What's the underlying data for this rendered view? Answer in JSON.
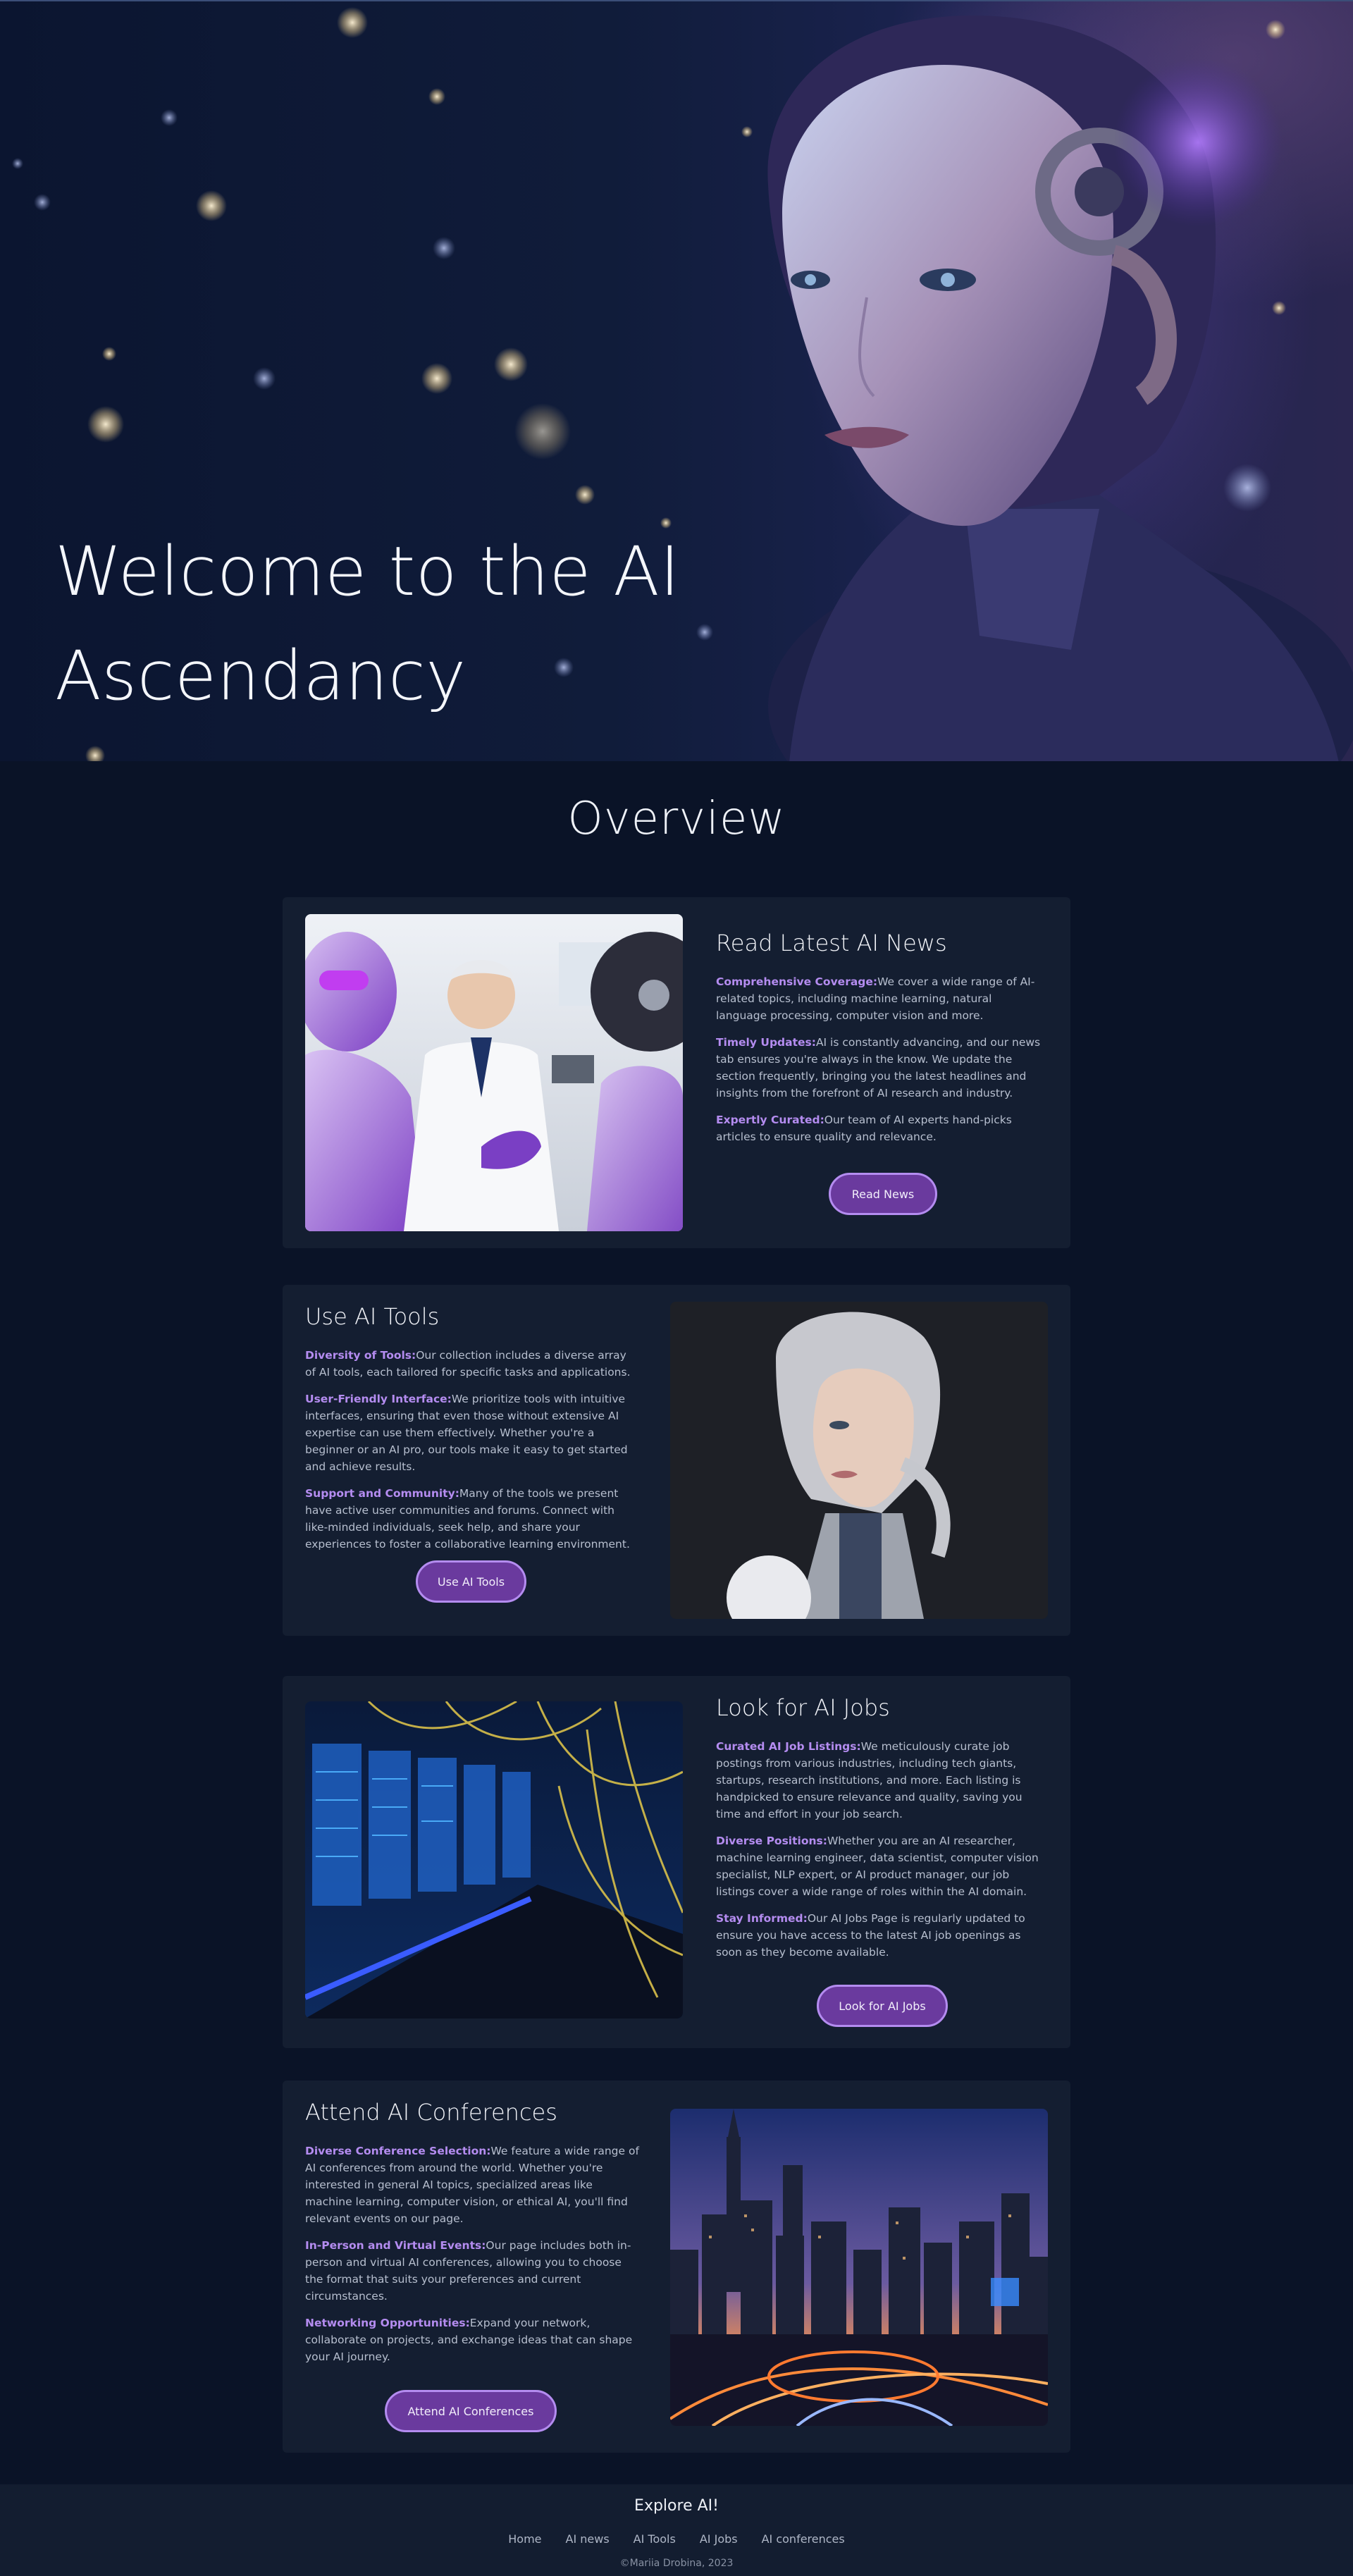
{
  "hero": {
    "title_line1": "Welcome to the AI",
    "title_line2": "Ascendancy"
  },
  "overview": {
    "title": "Overview"
  },
  "sections": [
    {
      "title": "Read Latest AI News",
      "points": [
        {
          "label": "Comprehensive Coverage:",
          "text": "We cover a wide range of AI-related topics, including machine learning, natural language processing, computer vision and more."
        },
        {
          "label": "Timely Updates:",
          "text": "AI is constantly advancing, and our news tab ensures you're always in the know. We update the section frequently, bringing you the latest headlines and insights from the forefront of AI research and industry."
        },
        {
          "label": "Expertly Curated:",
          "text": "Our team of AI experts hand-picks articles to ensure quality and relevance."
        }
      ],
      "button": "Read News"
    },
    {
      "title": "Use AI Tools",
      "points": [
        {
          "label": "Diversity of Tools:",
          "text": "Our collection includes a diverse array of AI tools, each tailored for specific tasks and applications."
        },
        {
          "label": "User-Friendly Interface:",
          "text": "We prioritize tools with intuitive interfaces, ensuring that even those without extensive AI expertise can use them effectively. Whether you're a beginner or an AI pro, our tools make it easy to get started and achieve results."
        },
        {
          "label": "Support and Community:",
          "text": "Many of the tools we present have active user communities and forums. Connect with like-minded individuals, seek help, and share your experiences to foster a collaborative learning environment."
        }
      ],
      "button": "Use AI Tools"
    },
    {
      "title": "Look for AI Jobs",
      "points": [
        {
          "label": "Curated AI Job Listings:",
          "text": "We meticulously curate job postings from various industries, including tech giants, startups, research institutions, and more. Each listing is handpicked to ensure relevance and quality, saving you time and effort in your job search."
        },
        {
          "label": "Diverse Positions:",
          "text": "Whether you are an AI researcher, machine learning engineer, data scientist, computer vision specialist, NLP expert, or AI product manager, our job listings cover a wide range of roles within the AI domain."
        },
        {
          "label": "Stay Informed:",
          "text": "Our AI Jobs Page is regularly updated to ensure you have access to the latest AI job openings as soon as they become available."
        }
      ],
      "button": "Look for AI Jobs"
    },
    {
      "title": "Attend AI Conferences",
      "points": [
        {
          "label": "Diverse Conference Selection:",
          "text": "We feature a wide range of AI conferences from around the world. Whether you're interested in general AI topics, specialized areas like machine learning, computer vision, or ethical AI, you'll find relevant events on our page."
        },
        {
          "label": "In-Person and Virtual Events:",
          "text": "Our page includes both in-person and virtual AI conferences, allowing you to choose the format that suits your preferences and current circumstances."
        },
        {
          "label": "Networking Opportunities:",
          "text": "Expand your network, collaborate on projects, and exchange ideas that can shape your AI journey."
        }
      ],
      "button": "Attend AI Conferences"
    }
  ],
  "footer": {
    "title": "Explore AI!",
    "links": [
      "Home",
      "AI news",
      "AI Tools",
      "AI Jobs",
      "AI conferences"
    ],
    "copyright": "©Mariia Drobina, 2023"
  },
  "colors": {
    "background": "#0a1327",
    "card": "#141e31",
    "accent": "#b48cf0",
    "button_fill": "#6a3a9e"
  }
}
